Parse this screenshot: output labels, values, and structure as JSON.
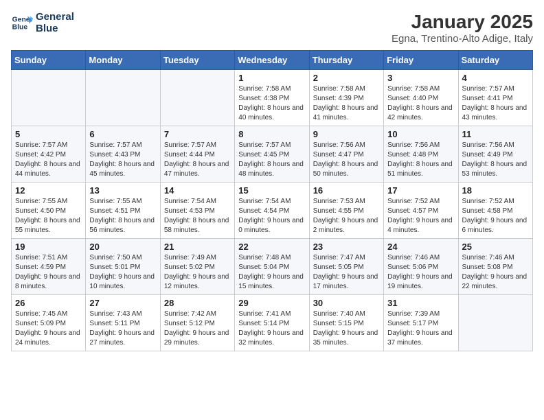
{
  "logo": {
    "line1": "General",
    "line2": "Blue"
  },
  "title": "January 2025",
  "subtitle": "Egna, Trentino-Alto Adige, Italy",
  "weekdays": [
    "Sunday",
    "Monday",
    "Tuesday",
    "Wednesday",
    "Thursday",
    "Friday",
    "Saturday"
  ],
  "weeks": [
    [
      {
        "day": "",
        "sunrise": "",
        "sunset": "",
        "daylight": ""
      },
      {
        "day": "",
        "sunrise": "",
        "sunset": "",
        "daylight": ""
      },
      {
        "day": "",
        "sunrise": "",
        "sunset": "",
        "daylight": ""
      },
      {
        "day": "1",
        "sunrise": "Sunrise: 7:58 AM",
        "sunset": "Sunset: 4:38 PM",
        "daylight": "Daylight: 8 hours and 40 minutes."
      },
      {
        "day": "2",
        "sunrise": "Sunrise: 7:58 AM",
        "sunset": "Sunset: 4:39 PM",
        "daylight": "Daylight: 8 hours and 41 minutes."
      },
      {
        "day": "3",
        "sunrise": "Sunrise: 7:58 AM",
        "sunset": "Sunset: 4:40 PM",
        "daylight": "Daylight: 8 hours and 42 minutes."
      },
      {
        "day": "4",
        "sunrise": "Sunrise: 7:57 AM",
        "sunset": "Sunset: 4:41 PM",
        "daylight": "Daylight: 8 hours and 43 minutes."
      }
    ],
    [
      {
        "day": "5",
        "sunrise": "Sunrise: 7:57 AM",
        "sunset": "Sunset: 4:42 PM",
        "daylight": "Daylight: 8 hours and 44 minutes."
      },
      {
        "day": "6",
        "sunrise": "Sunrise: 7:57 AM",
        "sunset": "Sunset: 4:43 PM",
        "daylight": "Daylight: 8 hours and 45 minutes."
      },
      {
        "day": "7",
        "sunrise": "Sunrise: 7:57 AM",
        "sunset": "Sunset: 4:44 PM",
        "daylight": "Daylight: 8 hours and 47 minutes."
      },
      {
        "day": "8",
        "sunrise": "Sunrise: 7:57 AM",
        "sunset": "Sunset: 4:45 PM",
        "daylight": "Daylight: 8 hours and 48 minutes."
      },
      {
        "day": "9",
        "sunrise": "Sunrise: 7:56 AM",
        "sunset": "Sunset: 4:47 PM",
        "daylight": "Daylight: 8 hours and 50 minutes."
      },
      {
        "day": "10",
        "sunrise": "Sunrise: 7:56 AM",
        "sunset": "Sunset: 4:48 PM",
        "daylight": "Daylight: 8 hours and 51 minutes."
      },
      {
        "day": "11",
        "sunrise": "Sunrise: 7:56 AM",
        "sunset": "Sunset: 4:49 PM",
        "daylight": "Daylight: 8 hours and 53 minutes."
      }
    ],
    [
      {
        "day": "12",
        "sunrise": "Sunrise: 7:55 AM",
        "sunset": "Sunset: 4:50 PM",
        "daylight": "Daylight: 8 hours and 55 minutes."
      },
      {
        "day": "13",
        "sunrise": "Sunrise: 7:55 AM",
        "sunset": "Sunset: 4:51 PM",
        "daylight": "Daylight: 8 hours and 56 minutes."
      },
      {
        "day": "14",
        "sunrise": "Sunrise: 7:54 AM",
        "sunset": "Sunset: 4:53 PM",
        "daylight": "Daylight: 8 hours and 58 minutes."
      },
      {
        "day": "15",
        "sunrise": "Sunrise: 7:54 AM",
        "sunset": "Sunset: 4:54 PM",
        "daylight": "Daylight: 9 hours and 0 minutes."
      },
      {
        "day": "16",
        "sunrise": "Sunrise: 7:53 AM",
        "sunset": "Sunset: 4:55 PM",
        "daylight": "Daylight: 9 hours and 2 minutes."
      },
      {
        "day": "17",
        "sunrise": "Sunrise: 7:52 AM",
        "sunset": "Sunset: 4:57 PM",
        "daylight": "Daylight: 9 hours and 4 minutes."
      },
      {
        "day": "18",
        "sunrise": "Sunrise: 7:52 AM",
        "sunset": "Sunset: 4:58 PM",
        "daylight": "Daylight: 9 hours and 6 minutes."
      }
    ],
    [
      {
        "day": "19",
        "sunrise": "Sunrise: 7:51 AM",
        "sunset": "Sunset: 4:59 PM",
        "daylight": "Daylight: 9 hours and 8 minutes."
      },
      {
        "day": "20",
        "sunrise": "Sunrise: 7:50 AM",
        "sunset": "Sunset: 5:01 PM",
        "daylight": "Daylight: 9 hours and 10 minutes."
      },
      {
        "day": "21",
        "sunrise": "Sunrise: 7:49 AM",
        "sunset": "Sunset: 5:02 PM",
        "daylight": "Daylight: 9 hours and 12 minutes."
      },
      {
        "day": "22",
        "sunrise": "Sunrise: 7:48 AM",
        "sunset": "Sunset: 5:04 PM",
        "daylight": "Daylight: 9 hours and 15 minutes."
      },
      {
        "day": "23",
        "sunrise": "Sunrise: 7:47 AM",
        "sunset": "Sunset: 5:05 PM",
        "daylight": "Daylight: 9 hours and 17 minutes."
      },
      {
        "day": "24",
        "sunrise": "Sunrise: 7:46 AM",
        "sunset": "Sunset: 5:06 PM",
        "daylight": "Daylight: 9 hours and 19 minutes."
      },
      {
        "day": "25",
        "sunrise": "Sunrise: 7:46 AM",
        "sunset": "Sunset: 5:08 PM",
        "daylight": "Daylight: 9 hours and 22 minutes."
      }
    ],
    [
      {
        "day": "26",
        "sunrise": "Sunrise: 7:45 AM",
        "sunset": "Sunset: 5:09 PM",
        "daylight": "Daylight: 9 hours and 24 minutes."
      },
      {
        "day": "27",
        "sunrise": "Sunrise: 7:43 AM",
        "sunset": "Sunset: 5:11 PM",
        "daylight": "Daylight: 9 hours and 27 minutes."
      },
      {
        "day": "28",
        "sunrise": "Sunrise: 7:42 AM",
        "sunset": "Sunset: 5:12 PM",
        "daylight": "Daylight: 9 hours and 29 minutes."
      },
      {
        "day": "29",
        "sunrise": "Sunrise: 7:41 AM",
        "sunset": "Sunset: 5:14 PM",
        "daylight": "Daylight: 9 hours and 32 minutes."
      },
      {
        "day": "30",
        "sunrise": "Sunrise: 7:40 AM",
        "sunset": "Sunset: 5:15 PM",
        "daylight": "Daylight: 9 hours and 35 minutes."
      },
      {
        "day": "31",
        "sunrise": "Sunrise: 7:39 AM",
        "sunset": "Sunset: 5:17 PM",
        "daylight": "Daylight: 9 hours and 37 minutes."
      },
      {
        "day": "",
        "sunrise": "",
        "sunset": "",
        "daylight": ""
      }
    ]
  ]
}
